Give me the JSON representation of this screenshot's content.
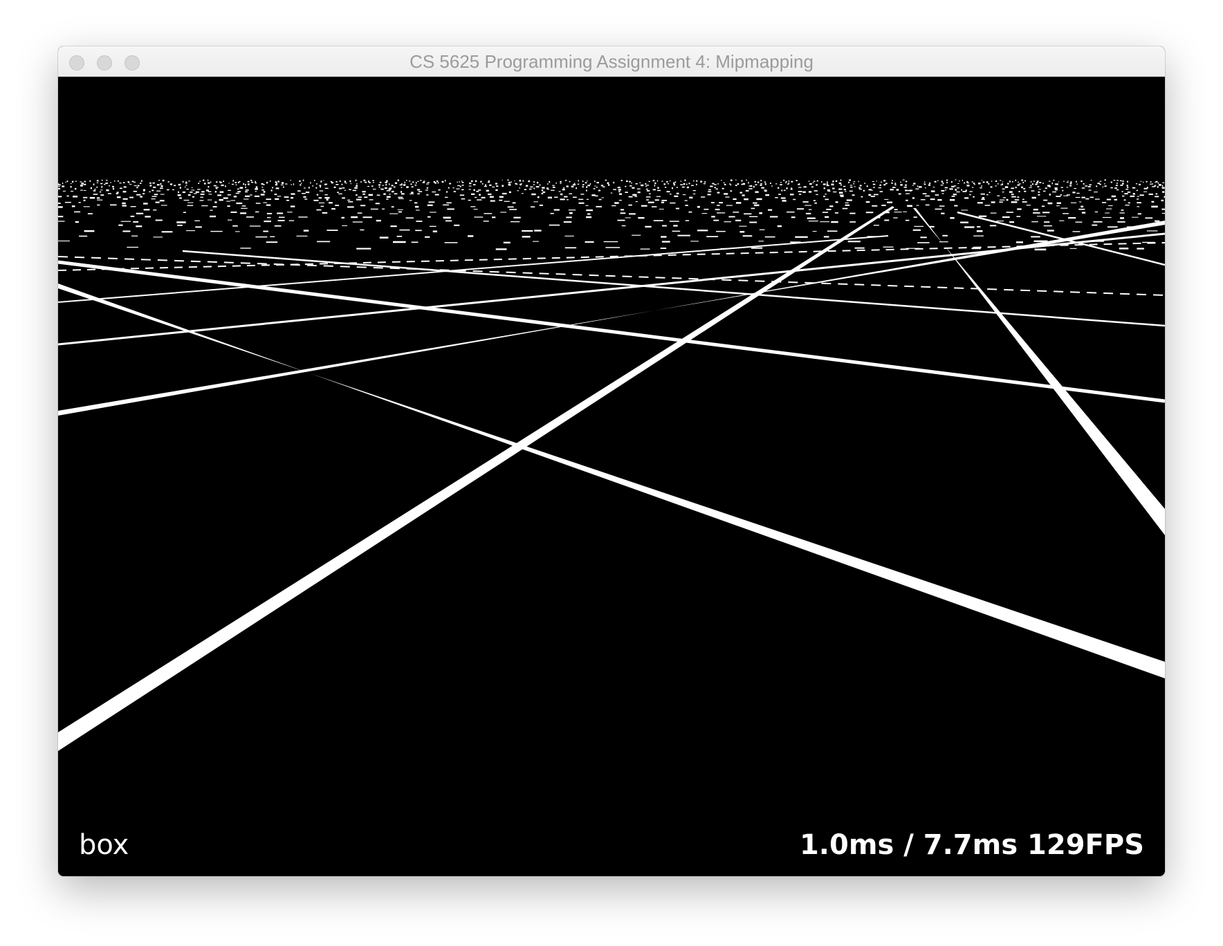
{
  "window": {
    "title": "CS 5625 Programming Assignment 4: Mipmapping"
  },
  "overlay": {
    "filter_mode": "box",
    "timing": "1.0ms / 7.7ms 129FPS"
  },
  "scene": {
    "background_color": "#000000",
    "line_color": "#ffffff"
  }
}
